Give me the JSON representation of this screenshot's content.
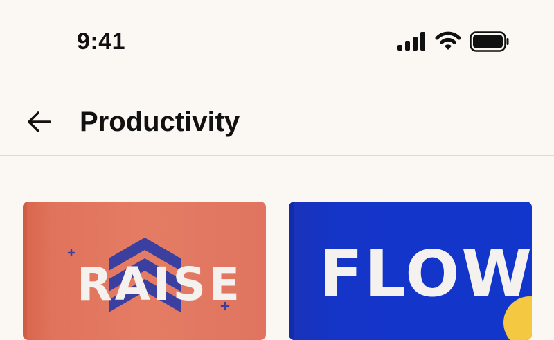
{
  "status_bar": {
    "time": "9:41",
    "icons": [
      "cellular-signal-icon",
      "wifi-icon",
      "battery-icon"
    ]
  },
  "header": {
    "back_icon": "arrow-left-icon",
    "title": "Productivity"
  },
  "cards": [
    {
      "title": "RAISE",
      "background": "#e47c63",
      "accent": "#3a3fa0"
    },
    {
      "title": "FLOW",
      "background": "#1235cb",
      "accent": "#f5c842"
    }
  ],
  "colors": {
    "page_background": "#fbf7f2",
    "divider": "#dedad5",
    "text": "#111111"
  }
}
